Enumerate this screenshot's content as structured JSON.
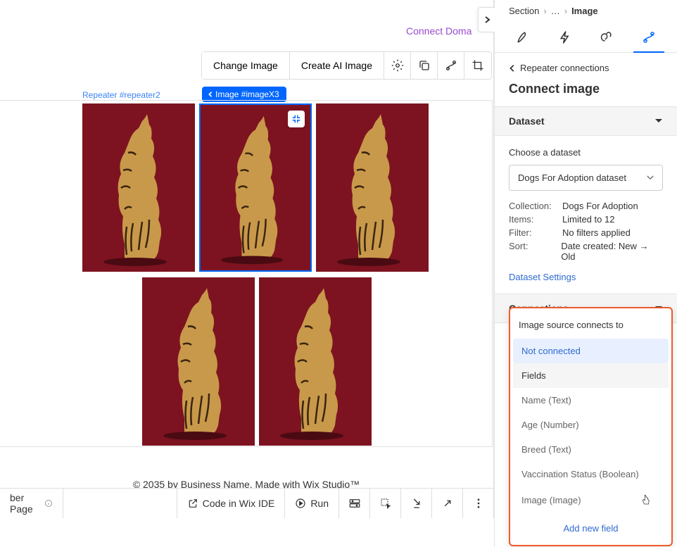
{
  "topbar": {
    "connect_domain": "Connect Doma"
  },
  "toolbar": {
    "change_image": "Change Image",
    "create_ai_image": "Create AI Image"
  },
  "labels": {
    "repeater": "Repeater #repeater2",
    "image": "Image #imageX3"
  },
  "footer": {
    "prefix": "© 2035 by Business Name. Made with ",
    "link": "Wix Studio™"
  },
  "bottombar": {
    "page": "ber Page",
    "code_ide": "Code in Wix IDE",
    "run": "Run"
  },
  "breadcrumb": {
    "section": "Section",
    "sep1": "›",
    "ellipsis": "…",
    "sep2": "›",
    "current": "Image"
  },
  "panel": {
    "back_label": "Repeater connections",
    "title": "Connect image",
    "dataset_section": "Dataset",
    "choose_dataset_label": "Choose a dataset",
    "selected_dataset": "Dogs For Adoption dataset",
    "meta": {
      "collection_k": "Collection:",
      "collection_v": "Dogs For Adoption",
      "items_k": "Items:",
      "items_v": "Limited to 12",
      "filter_k": "Filter:",
      "filter_v": "No filters applied",
      "sort_k": "Sort:",
      "sort_v": "Date created: New → Old"
    },
    "dataset_settings": "Dataset Settings",
    "connections_section": "Connections",
    "connects_to_label": "Image source connects to",
    "not_connected": "Not connected",
    "fields_header": "Fields",
    "fields": {
      "name": "Name (Text)",
      "age": "Age (Number)",
      "breed": "Breed (Text)",
      "vacc": "Vaccination Status (Boolean)",
      "image": "Image (Image)"
    },
    "add_new_field": "Add new field"
  }
}
